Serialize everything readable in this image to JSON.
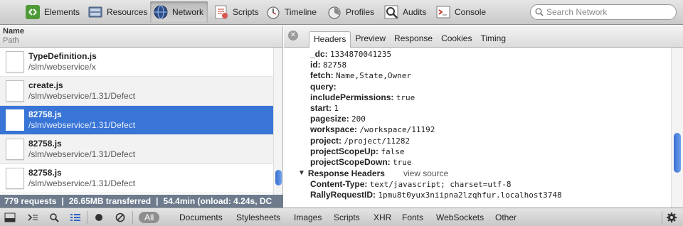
{
  "toolbar": {
    "items": [
      {
        "label": "Elements",
        "icon": "elements-icon"
      },
      {
        "label": "Resources",
        "icon": "resources-icon"
      },
      {
        "label": "Network",
        "icon": "network-icon",
        "active": true
      },
      {
        "label": "Scripts",
        "icon": "scripts-icon"
      },
      {
        "label": "Timeline",
        "icon": "timeline-icon"
      },
      {
        "label": "Profiles",
        "icon": "profiles-icon"
      },
      {
        "label": "Audits",
        "icon": "audits-icon"
      },
      {
        "label": "Console",
        "icon": "console-icon"
      }
    ],
    "search_placeholder": "Search Network"
  },
  "requests": {
    "header_name": "Name",
    "header_path": "Path",
    "rows": [
      {
        "name": "TypeDefinition.js",
        "path": "/slm/webservice/x"
      },
      {
        "name": "create.js",
        "path": "/slm/webservice/1.31/Defect"
      },
      {
        "name": "82758.js",
        "path": "/slm/webservice/1.31/Defect",
        "selected": true
      },
      {
        "name": "82758.js",
        "path": "/slm/webservice/1.31/Defect"
      },
      {
        "name": "82758.js",
        "path": "/slm/webservice/1.31/Defect"
      }
    ]
  },
  "status": {
    "requests": "779 requests",
    "transferred": "26.65MB transferred",
    "timing": "54.4min (onload: 4.24s, DC"
  },
  "details": {
    "tabs": [
      "Headers",
      "Preview",
      "Response",
      "Cookies",
      "Timing"
    ],
    "params": [
      {
        "k": "_dc:",
        "v": "1334870041235"
      },
      {
        "k": "id:",
        "v": "82758"
      },
      {
        "k": "fetch:",
        "v": "Name,State,Owner"
      },
      {
        "k": "query:",
        "v": ""
      },
      {
        "k": "includePermissions:",
        "v": "true"
      },
      {
        "k": "start:",
        "v": "1"
      },
      {
        "k": "pagesize:",
        "v": "200"
      },
      {
        "k": "workspace:",
        "v": "/workspace/11192"
      },
      {
        "k": "project:",
        "v": "/project/11282"
      },
      {
        "k": "projectScopeUp:",
        "v": "false"
      },
      {
        "k": "projectScopeDown:",
        "v": "true"
      }
    ],
    "response_headers_title": "Response Headers",
    "view_source": "view source",
    "response_headers": [
      {
        "k": "Content-Type:",
        "v": "text/javascript;  charset=utf-8"
      },
      {
        "k": "RallyRequestID:",
        "v": "1pmu8t0yux3niipna2lzqhfur.localhost3748"
      }
    ]
  },
  "filters": {
    "all": "All",
    "items": [
      "Documents",
      "Stylesheets",
      "Images",
      "Scripts",
      "XHR",
      "Fonts",
      "WebSockets",
      "Other"
    ]
  },
  "colors": {
    "selection": "#3875d7",
    "statusbar": "#6d7b8d"
  }
}
